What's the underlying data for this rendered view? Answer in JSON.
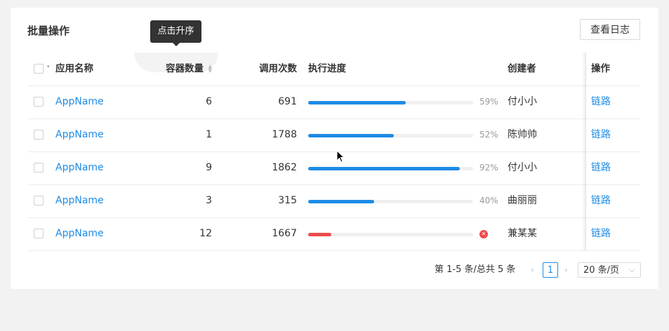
{
  "header": {
    "title": "批量操作",
    "log_button": "查看日志"
  },
  "tooltip": "点击升序",
  "columns": {
    "name": "应用名称",
    "count": "容器数量",
    "calls": "调用次数",
    "progress": "执行进度",
    "creator": "创建者",
    "op": "操作"
  },
  "rows": [
    {
      "name": "AppName",
      "count": "6",
      "calls": "691",
      "progress": 0.59,
      "progress_label": "59%",
      "status": "normal",
      "creator": "付小小",
      "op": "链路"
    },
    {
      "name": "AppName",
      "count": "1",
      "calls": "1788",
      "progress": 0.52,
      "progress_label": "52%",
      "status": "normal",
      "creator": "陈帅帅",
      "op": "链路"
    },
    {
      "name": "AppName",
      "count": "9",
      "calls": "1862",
      "progress": 0.92,
      "progress_label": "92%",
      "status": "normal",
      "creator": "付小小",
      "op": "链路"
    },
    {
      "name": "AppName",
      "count": "3",
      "calls": "315",
      "progress": 0.4,
      "progress_label": "40%",
      "status": "normal",
      "creator": "曲丽丽",
      "op": "链路"
    },
    {
      "name": "AppName",
      "count": "12",
      "calls": "1667",
      "progress": 0.14,
      "progress_label": "",
      "status": "error",
      "creator": "兼某某",
      "op": "链路"
    }
  ],
  "pagination": {
    "summary": "第 1-5 条/总共 5 条",
    "current_page": "1",
    "page_size": "20 条/页"
  },
  "colors": {
    "link": "#1e8ce6",
    "progress": "#1e8ce6",
    "error": "#ee4b4b",
    "track": "#f0f0f0"
  }
}
